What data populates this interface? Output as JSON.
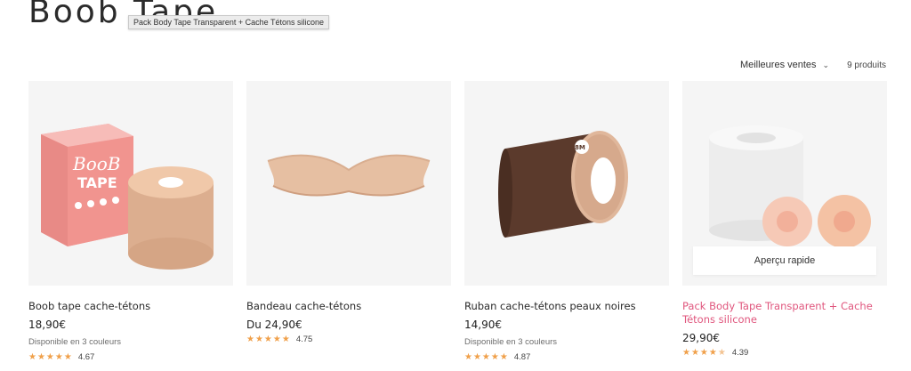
{
  "page": {
    "title": "Boob Tape"
  },
  "tooltip": "Pack Body Tape Transparent + Cache Tétons silicone",
  "sort": {
    "label": "Meilleures ventes",
    "count": "9 produits"
  },
  "quick_view_label": "Aperçu rapide",
  "products": [
    {
      "title": "Boob tape cache-tétons",
      "price": "18,90€",
      "availability": "Disponible en 3 couleurs",
      "rating": "4.67",
      "stars": "★★★★★"
    },
    {
      "title": "Bandeau cache-tétons",
      "price": "Du 24,90€",
      "availability": "",
      "rating": "4.75",
      "stars": "★★★★★"
    },
    {
      "title": "Ruban cache-tétons peaux noires",
      "price": "14,90€",
      "availability": "Disponible en 3 couleurs",
      "rating": "4.87",
      "stars": "★★★★★"
    },
    {
      "title": "Pack Body Tape Transparent + Cache Tétons silicone",
      "price": "29,90€",
      "availability": "",
      "rating": "4.39",
      "stars": "★★★★"
    }
  ],
  "box_text": {
    "line1": "BooB",
    "line2": "TAPE"
  },
  "roll_label": "8M",
  "colors": {
    "accent_pink": "#e0577e",
    "star": "#f0a04a",
    "card_bg": "#f5f5f5"
  }
}
